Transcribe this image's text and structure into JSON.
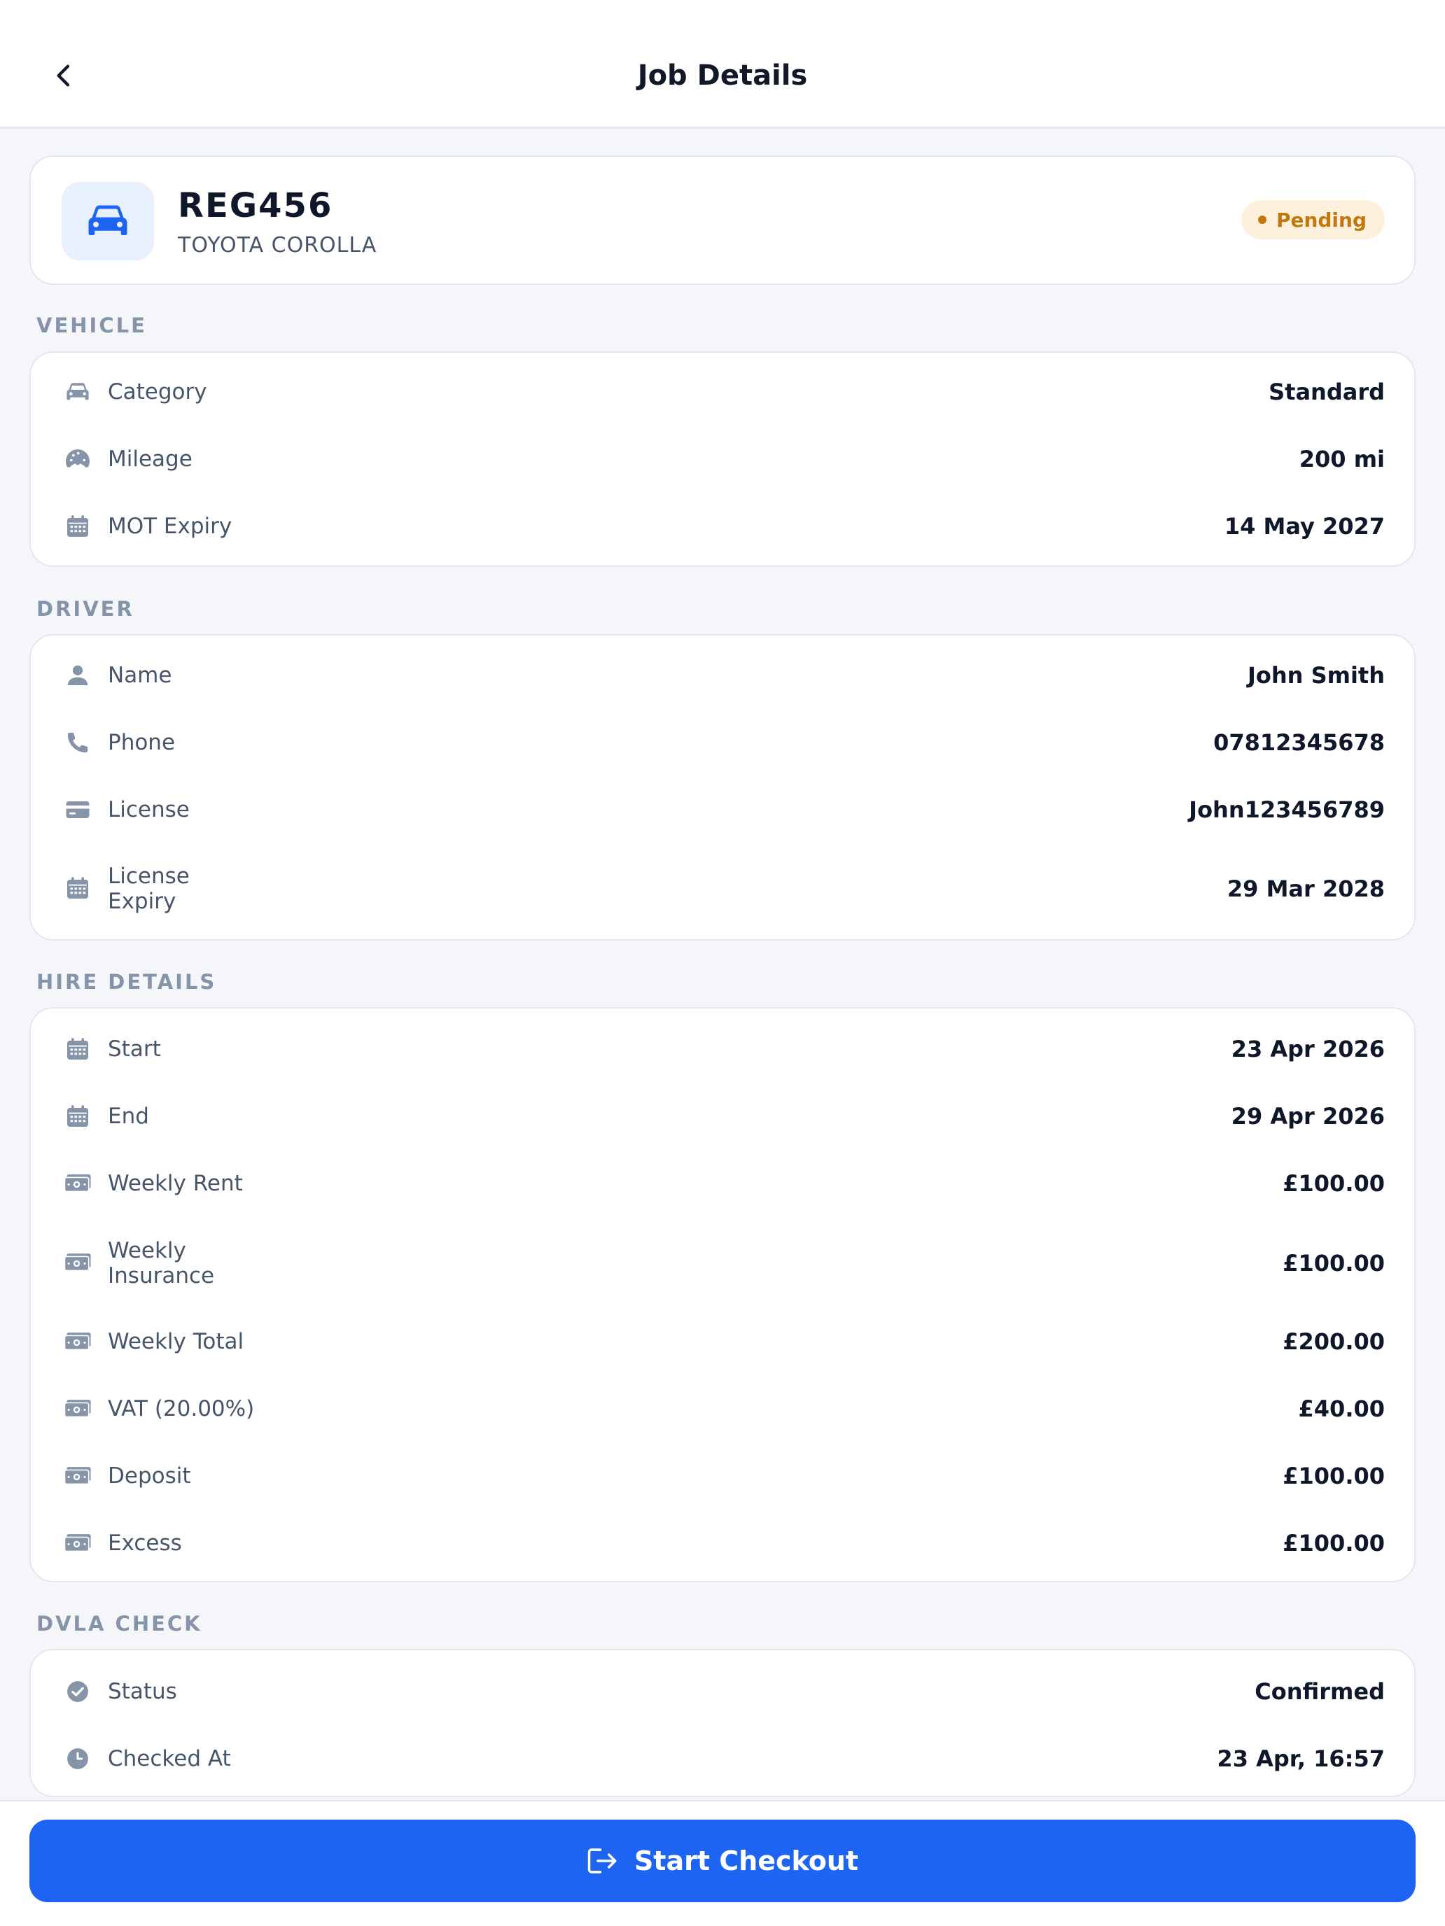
{
  "header": {
    "title": "Job Details",
    "back_icon": "chevron-left-icon"
  },
  "vehicle_summary": {
    "registration": "REG456",
    "model": "TOYOTA COROLLA",
    "status": "Pending",
    "status_color": "#c2780c",
    "icon": "car-icon",
    "accent_color": "#1d64f2"
  },
  "sections": {
    "vehicle": {
      "label": "VEHICLE",
      "rows": [
        {
          "icon": "car-icon",
          "label": "Category",
          "value": "Standard"
        },
        {
          "icon": "speedometer-icon",
          "label": "Mileage",
          "value": "200 mi"
        },
        {
          "icon": "calendar-icon",
          "label": "MOT Expiry",
          "value": "14 May 2027"
        }
      ]
    },
    "driver": {
      "label": "DRIVER",
      "rows": [
        {
          "icon": "person-icon",
          "label": "Name",
          "value": "John Smith"
        },
        {
          "icon": "phone-icon",
          "label": "Phone",
          "value": "07812345678"
        },
        {
          "icon": "card-icon",
          "label": "License",
          "value": "John123456789"
        },
        {
          "icon": "calendar-icon",
          "label": "License Expiry",
          "value": "29 Mar 2028"
        }
      ]
    },
    "hire": {
      "label": "HIRE DETAILS",
      "rows": [
        {
          "icon": "calendar-icon",
          "label": "Start",
          "value": "23 Apr 2026"
        },
        {
          "icon": "calendar-icon",
          "label": "End",
          "value": "29 Apr 2026"
        },
        {
          "icon": "banknote-icon",
          "label": "Weekly Rent",
          "value": "£100.00"
        },
        {
          "icon": "banknote-icon",
          "label": "Weekly Insurance",
          "value": "£100.00"
        },
        {
          "icon": "banknote-icon",
          "label": "Weekly Total",
          "value": "£200.00"
        },
        {
          "icon": "banknote-icon",
          "label": "VAT (20.00%)",
          "value": "£40.00"
        },
        {
          "icon": "banknote-icon",
          "label": "Deposit",
          "value": "£100.00"
        },
        {
          "icon": "banknote-icon",
          "label": "Excess",
          "value": "£100.00"
        }
      ]
    },
    "dvla": {
      "label": "DVLA CHECK",
      "rows": [
        {
          "icon": "check-circle-icon",
          "label": "Status",
          "value": "Confirmed"
        },
        {
          "icon": "clock-icon",
          "label": "Checked At",
          "value": "23 Apr, 16:57"
        }
      ]
    }
  },
  "footer": {
    "button_label": "Start Checkout",
    "button_icon": "exit-icon"
  }
}
